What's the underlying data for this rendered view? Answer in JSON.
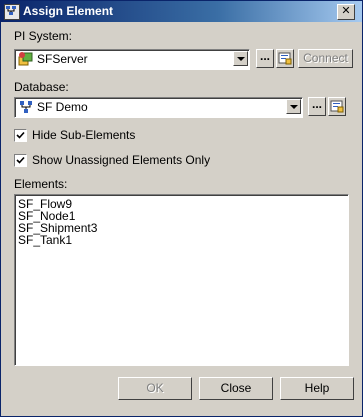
{
  "window": {
    "title": "Assign Element",
    "close_glyph": "✕"
  },
  "pi_system": {
    "label": "PI System:",
    "selected": "SFServer",
    "icon": "pi-server-icon",
    "browse_label": "...",
    "connect_label": "Connect"
  },
  "database": {
    "label": "Database:",
    "selected": "SF Demo",
    "icon": "database-icon",
    "browse_label": "..."
  },
  "options": {
    "hide_sub_elements": {
      "label": "Hide Sub-Elements",
      "checked": true
    },
    "show_unassigned": {
      "label": "Show Unassigned Elements Only",
      "checked": true
    }
  },
  "elements": {
    "label": "Elements:",
    "items": [
      "SF_Flow9",
      "SF_Node1",
      "SF_Shipment3",
      "SF_Tank1"
    ]
  },
  "buttons": {
    "ok_label": "OK",
    "close_label": "Close",
    "help_label": "Help"
  }
}
